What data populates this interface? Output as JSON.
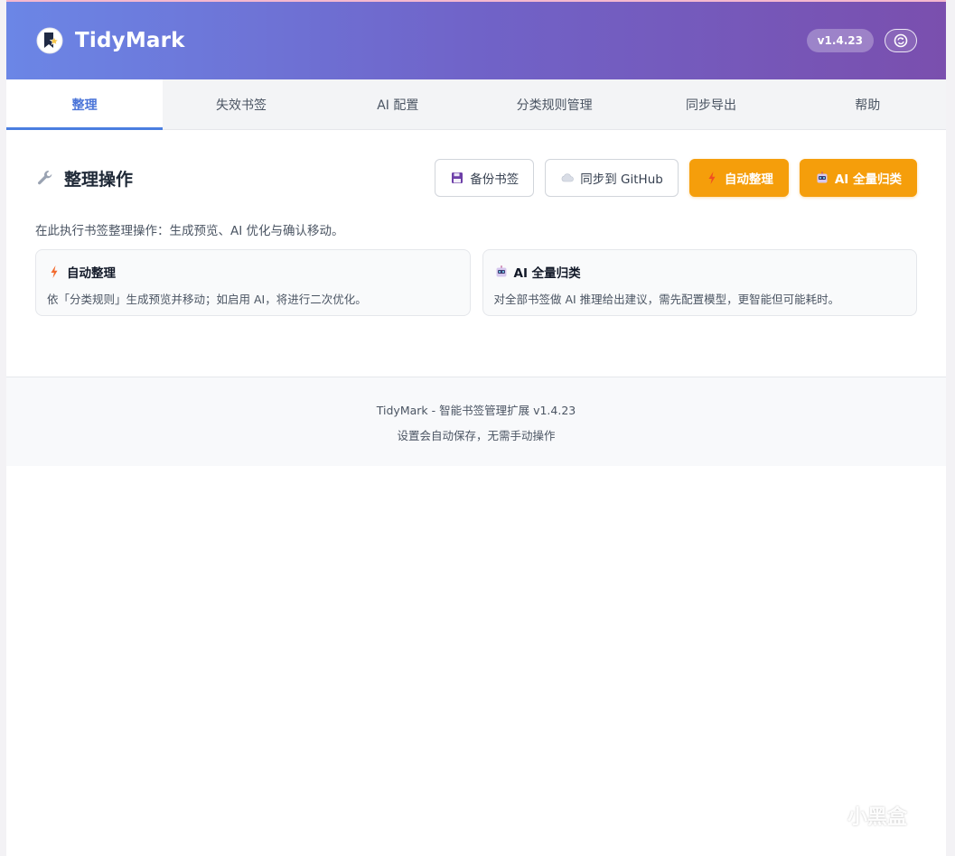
{
  "header": {
    "app_title": "TidyMark",
    "version_badge": "v1.4.23",
    "logo_icon": "bookmark-star-icon",
    "right_icon": "sync-icon"
  },
  "tabs": [
    {
      "label": "整理",
      "active": true
    },
    {
      "label": "失效书签",
      "active": false
    },
    {
      "label": "AI 配置",
      "active": false
    },
    {
      "label": "分类规则管理",
      "active": false
    },
    {
      "label": "同步导出",
      "active": false
    },
    {
      "label": "帮助",
      "active": false
    }
  ],
  "main": {
    "section_title": "整理操作",
    "section_icon": "wrench-icon",
    "buttons": {
      "backup": "备份书签",
      "sync_github": "同步到 GitHub",
      "auto_organize": "自动整理",
      "ai_classify": "AI 全量归类"
    },
    "description": "在此执行书签整理操作：生成预览、AI 优化与确认移动。",
    "cards": [
      {
        "title": "自动整理",
        "text": "依「分类规则」生成预览并移动；如启用 AI，将进行二次优化。",
        "icon": "lightning-icon"
      },
      {
        "title": "AI 全量归类",
        "text": "对全部书签做 AI 推理给出建议，需先配置模型，更智能但可能耗时。",
        "icon": "robot-icon"
      }
    ]
  },
  "footer": {
    "line1": "TidyMark - 智能书签管理扩展 v1.4.23",
    "line2": "设置会自动保存，无需手动操作"
  },
  "watermark": {
    "text": "小黑盒"
  },
  "colors": {
    "header_gradient_start": "#6b86e6",
    "header_gradient_end": "#7a4fae",
    "accent_blue": "#4a7ee0",
    "orange": "#f59e0b"
  }
}
